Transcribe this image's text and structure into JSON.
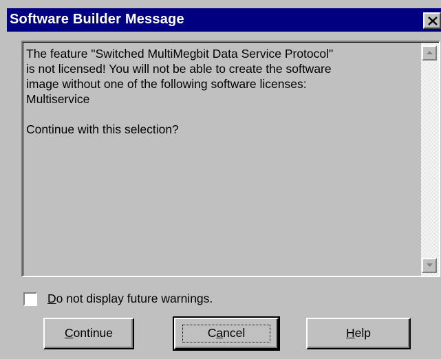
{
  "window": {
    "title": "Software Builder Message",
    "close_glyph": "✕"
  },
  "message": {
    "text": "The feature \"Switched MultiMegbit Data Service Protocol\"\nis not licensed! You will not be able to create the software\nimage without one of the following software licenses:\nMultiservice\n\nContinue with this selection?"
  },
  "scrollbar": {
    "up_icon": "scroll-up-arrow-icon",
    "down_icon": "scroll-down-arrow-icon"
  },
  "checkbox": {
    "label_access": "D",
    "label_rest": "o not display future warnings.",
    "checked": false
  },
  "buttons": {
    "continue_access": "C",
    "continue_rest": "ontinue",
    "cancel_pre": "C",
    "cancel_access": "a",
    "cancel_rest": "ncel",
    "help_access": "H",
    "help_rest": "elp"
  },
  "colors": {
    "titlebar": "#000080",
    "face": "#c0c0c0",
    "title_text": "#ffffff"
  }
}
